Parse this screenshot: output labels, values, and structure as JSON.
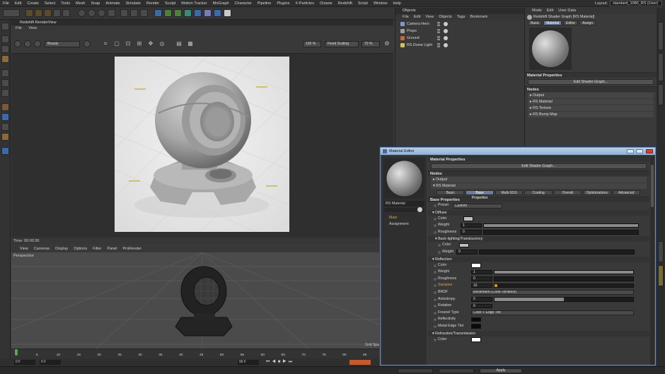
{
  "menubar": {
    "items": [
      "File",
      "Edit",
      "Create",
      "Select",
      "Tools",
      "Mesh",
      "Snap",
      "Animate",
      "Simulate",
      "Render",
      "Sculpt",
      "Motion Tracker",
      "MoGraph",
      "Character",
      "Pipeline",
      "Plugins",
      "X-Particles",
      "Octane",
      "Redshift",
      "Script",
      "Window",
      "Help"
    ],
    "layout_label": "Layout:",
    "layout_value": "standard_1080_RS (User)"
  },
  "renderview": {
    "title": "Redshift RenderView",
    "menu": [
      "File",
      "View"
    ],
    "aov": "Beauty",
    "zoom": "100 %",
    "scaling": "Fixed Scaling",
    "percent": "70 %",
    "time": "Time: 00:00:30"
  },
  "viewport": {
    "menu": [
      "View",
      "Cameras",
      "Display",
      "Options",
      "Filter",
      "Panel",
      "ProRender"
    ],
    "label": "Perspective",
    "grid": "Grid Spacing : 1"
  },
  "timeline": {
    "ticks": [
      "0",
      "5",
      "10",
      "15",
      "20",
      "25",
      "30",
      "35",
      "40",
      "45",
      "50",
      "55",
      "60",
      "65",
      "70",
      "75",
      "80",
      "85",
      "90"
    ],
    "frame_start": "0 F",
    "frame_cur": "0 F",
    "frame_end": "90 F"
  },
  "objects": {
    "title": "Objects",
    "menu": [
      "File",
      "Edit",
      "View",
      "Objects",
      "Tags",
      "Bookmark"
    ],
    "rows": [
      {
        "name": "Camera Hero",
        "color": "#7a9cc6"
      },
      {
        "name": "Props",
        "color": "#a0a0a0"
      },
      {
        "name": "Ground",
        "color": "#c46a3e"
      },
      {
        "name": "RS Dome Light",
        "color": "#d0c060"
      }
    ]
  },
  "attributes": {
    "menu": [
      "Mode",
      "Edit",
      "User Data"
    ],
    "title": "Redshift Shader Graph [RS Material]",
    "tabs": [
      "Basic",
      "Material",
      "Editor",
      "Assign"
    ],
    "active_tab": "Material",
    "section": "Material Properties",
    "edit_button": "Edit Shader Graph...",
    "nodes_header": "Nodes",
    "nodes": [
      "Output",
      "RS Material",
      "RS Texture",
      "RS Bump Map"
    ]
  },
  "material_editor": {
    "title": "Material Editor",
    "material_name": "RS Material",
    "nav": [
      "Main",
      "Assignment"
    ],
    "props_header": "Material Properties",
    "edit_button": "Edit Shader Graph...",
    "nodes_header": "Nodes",
    "node_output": "Output",
    "node_rs": "RS Material",
    "tabs": [
      "Basic",
      "Base Properties",
      "Multi-SSS",
      "Coating",
      "Overall",
      "Optimizations",
      "Advanced"
    ],
    "active_tab": "Base Properties",
    "base_header": "Base Properties",
    "preset_label": "Preset",
    "preset_value": "Custom",
    "diffuse_header": "Diffuse",
    "diffuse": {
      "color": "Color",
      "weight_label": "Weight",
      "weight": "1",
      "rough_label": "Roughness",
      "rough": "0"
    },
    "backlight_header": "Back-lighting/Translucency",
    "backlight": {
      "color": "Color",
      "weight_label": "Weight",
      "weight": "0"
    },
    "reflection_header": "Reflection",
    "reflection": {
      "color": "Color",
      "weight_label": "Weight",
      "weight": "1",
      "rough_label": "Roughness",
      "rough": "0",
      "samples_label": "Samples",
      "samples": "16",
      "brdf_label": "BRDF",
      "brdf": "Beckmann (Cook-Torrance)",
      "aniso_label": "Anisotropy",
      "aniso": "0",
      "rotation_label": "Rotation",
      "rotation": "0",
      "fresnel_label": "Fresnel Type",
      "fresnel": "Color + Edge Tint",
      "reflectivity_label": "Reflectivity",
      "metal_label": "Metal Edge Tint"
    },
    "refraction_header": "Refraction/Transmission",
    "refraction": {
      "color": "Color"
    },
    "levels": {
      "diffuse_weight": 1.0,
      "diffuse_rough": 0.0,
      "back_weight": 0.0,
      "refl_weight": 1.0,
      "refl_rough": 0.0,
      "samples": 0.02,
      "aniso": 0.5
    }
  },
  "status": {
    "apply": "Apply"
  },
  "colors": {
    "accent": "#6b7d9a",
    "window_border": "#6f8fb5",
    "samples_label": "#e0a040"
  }
}
